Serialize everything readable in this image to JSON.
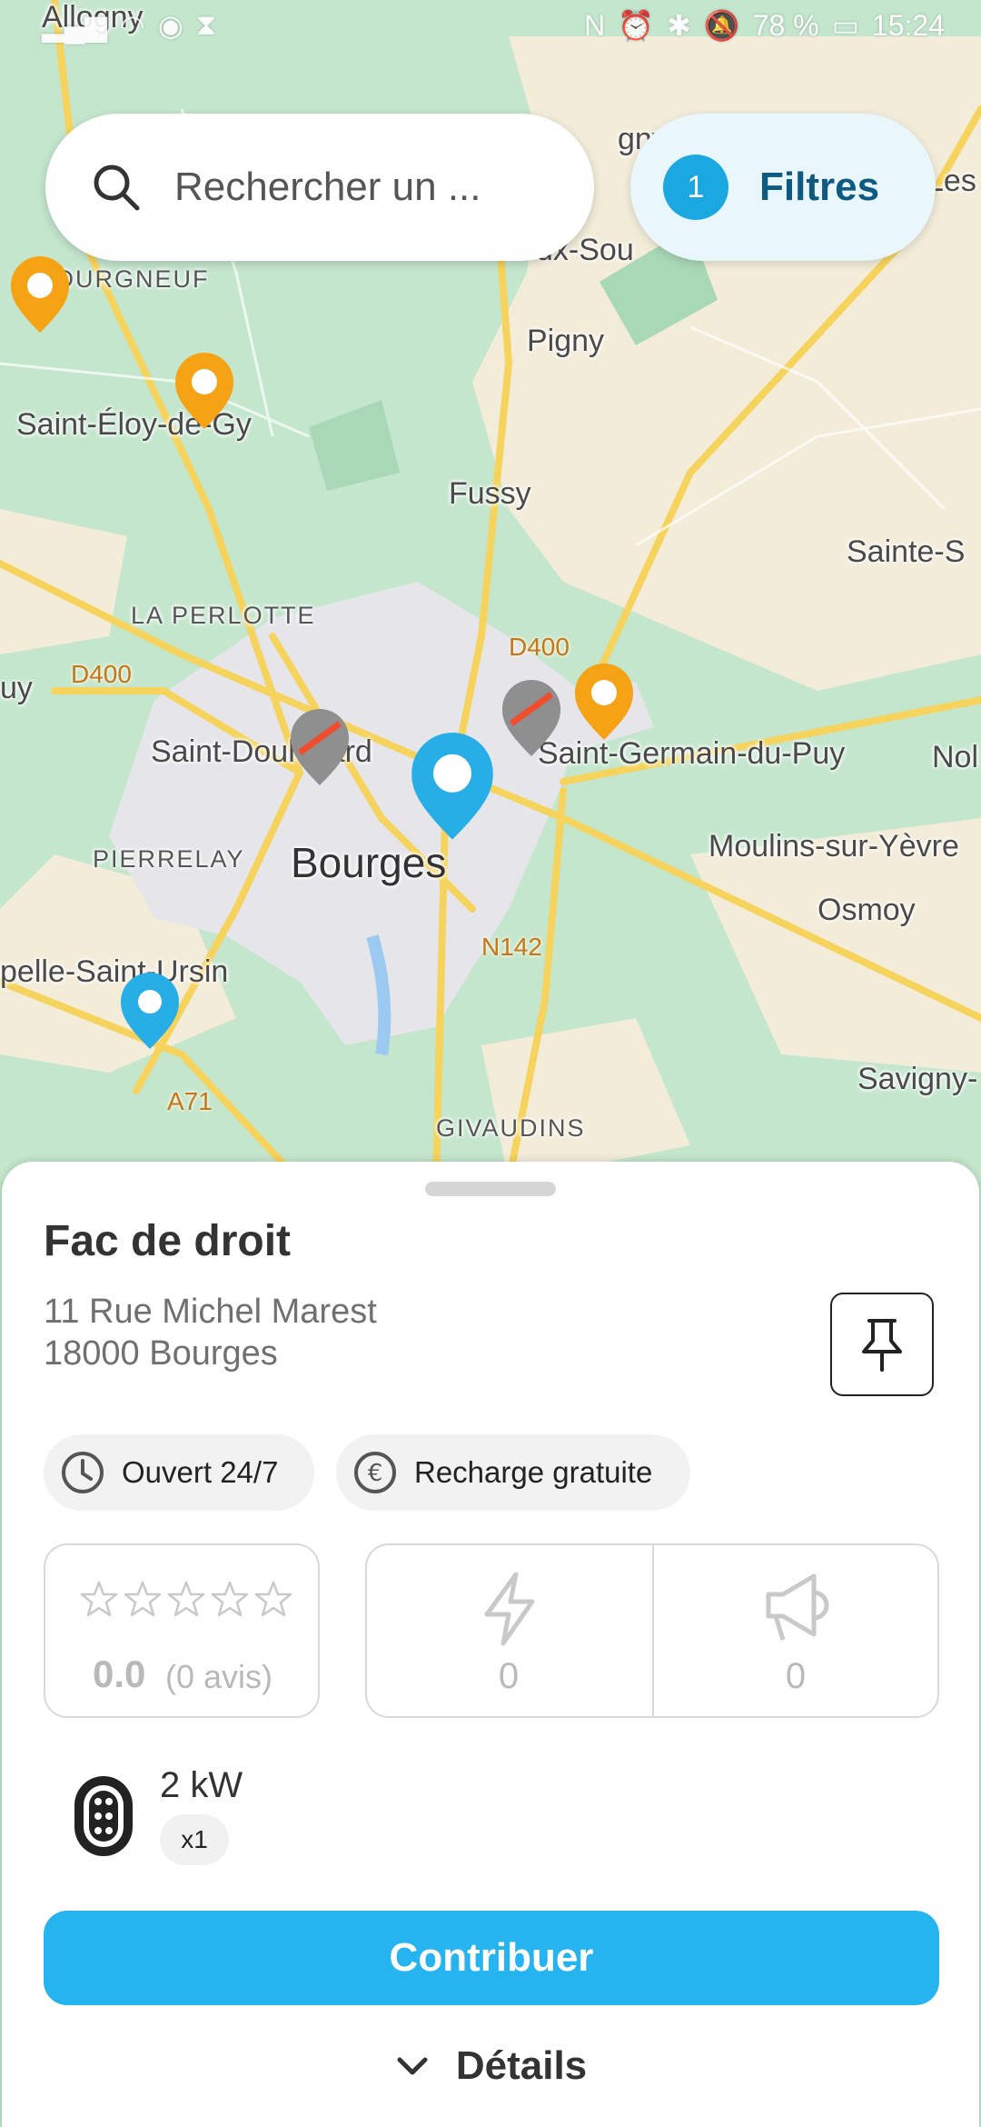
{
  "status_bar": {
    "time": "15:24",
    "battery": "78 %"
  },
  "search": {
    "placeholder": "Rechercher un ..."
  },
  "filters": {
    "count": "1",
    "label": "Filtres"
  },
  "map": {
    "places": {
      "allogny": "Allogny",
      "pigny": "Pigny",
      "bourgneuf": "OURGNEUF",
      "saint_eloy": "Saint-Éloy-de-Gy",
      "fussy": "Fussy",
      "sainte_s": "Sainte-S",
      "la_perlotte": "LA PERLOTTE",
      "saint_doulchard": "Saint-Doulchard",
      "saint_germain": "Saint-Germain-du-Puy",
      "nol": "Nol",
      "pierrelay": "PIERRELAY",
      "bourges": "Bourges",
      "moulins": "Moulins-sur-Yèvre",
      "osmoy": "Osmoy",
      "chapelle": "pelle-Saint-Ursin",
      "savigny": "Savigny-",
      "givaudins": "GIVAUDINS",
      "uy": "uy",
      "vasselay": "ux-Sou",
      "gny": "gny",
      "les": "Les"
    },
    "roads": {
      "d400_a": "D400",
      "d400_b": "D400",
      "n142": "N142",
      "a71": "A71"
    },
    "colors": {
      "urban": "#e6e6ea",
      "green": "#b9e0c4",
      "field": "#f3ecd9",
      "road": "#f6d35d"
    }
  },
  "station": {
    "name": "Fac de droit",
    "address_line1": "11 Rue Michel Marest",
    "address_line2": "18000 Bourges",
    "chips": {
      "hours": "Ouvert 24/7",
      "price": "Recharge gratuite"
    },
    "rating": {
      "value": "0.0",
      "count": "(0 avis)",
      "stars": 0
    },
    "stats": {
      "charges": "0",
      "reports": "0"
    },
    "connector": {
      "power": "2 kW",
      "quantity": "x1"
    }
  },
  "actions": {
    "contribute": "Contribuer",
    "details": "Détails"
  },
  "colors": {
    "accent": "#25b4ef",
    "marker_orange": "#f5a215",
    "marker_blue": "#27aee6",
    "marker_grey": "#8f8f8f"
  }
}
